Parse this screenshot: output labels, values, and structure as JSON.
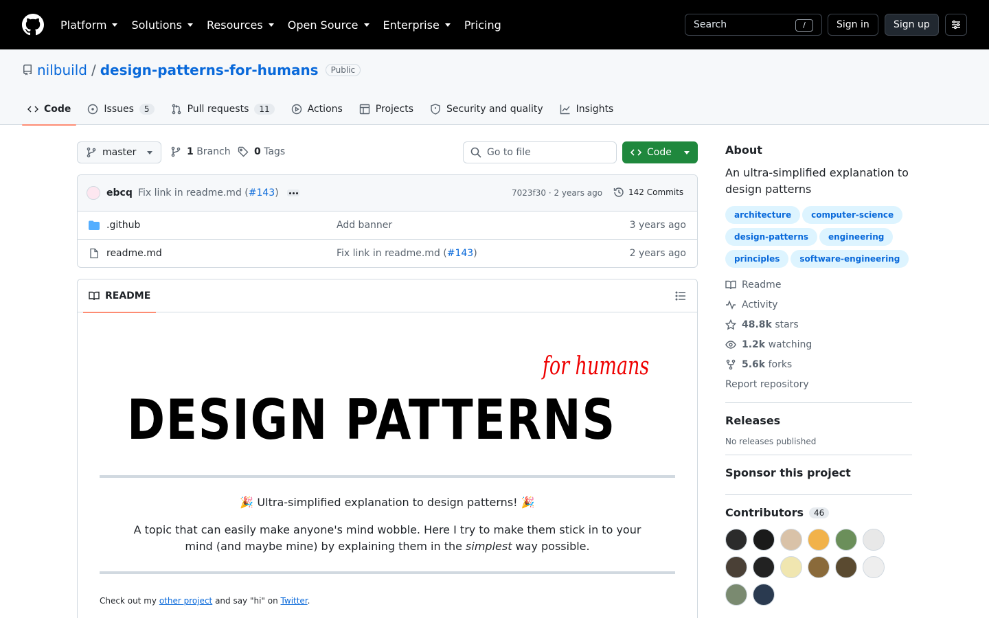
{
  "header": {
    "nav": [
      "Platform",
      "Solutions",
      "Resources",
      "Open Source",
      "Enterprise",
      "Pricing"
    ],
    "nav_dropdown": [
      true,
      true,
      true,
      true,
      true,
      false
    ],
    "search_label": "Search",
    "search_key": "/",
    "sign_in": "Sign in",
    "sign_up": "Sign up"
  },
  "repo": {
    "owner": "nilbuild",
    "separator": "/",
    "name": "design-patterns-for-humans",
    "visibility": "Public"
  },
  "tabs": [
    {
      "label": "Code",
      "icon": "code-icon",
      "count": ""
    },
    {
      "label": "Issues",
      "icon": "issue-icon",
      "count": "5"
    },
    {
      "label": "Pull requests",
      "icon": "pull-request-icon",
      "count": "11"
    },
    {
      "label": "Actions",
      "icon": "play-icon",
      "count": ""
    },
    {
      "label": "Projects",
      "icon": "table-icon",
      "count": ""
    },
    {
      "label": "Security and quality",
      "icon": "shield-icon",
      "count": ""
    },
    {
      "label": "Insights",
      "icon": "graph-icon",
      "count": ""
    }
  ],
  "toolbar": {
    "branch": "master",
    "branch_count": "1",
    "branch_label": "Branch",
    "tag_count": "0",
    "tag_label": "Tags",
    "goto_placeholder": "Go to file",
    "code_label": "Code"
  },
  "commit": {
    "author": "ebcq",
    "message": "Fix link in readme.md (",
    "pr": "#143",
    "message_end": ")",
    "sha_time": "7023f30 · 2 years ago",
    "commits": "142 Commits"
  },
  "files": [
    {
      "name": ".github",
      "type": "folder",
      "message": "Add banner",
      "message_link": "",
      "message_end": "",
      "date": "3 years ago"
    },
    {
      "name": "readme.md",
      "type": "file",
      "message": "Fix link in readme.md (",
      "message_link": "#143",
      "message_end": ")",
      "date": "2 years ago"
    }
  ],
  "readme": {
    "tab": "README",
    "banner_small": "for humans",
    "banner_big": "DESIGN PATTERNS",
    "lead": "🎉 Ultra-simplified explanation to design patterns! 🎉",
    "desc_1": "A topic that can easily make anyone's mind wobble. Here I try to make them stick in to your mind (and maybe mine) by explaining them in the ",
    "desc_em": "simplest",
    "desc_2": " way possible.",
    "checkout_1": "Check out my ",
    "checkout_link1": "other project",
    "checkout_2": " and say \"hi\" on ",
    "checkout_link2": "Twitter",
    "checkout_3": "."
  },
  "about": {
    "title": "About",
    "description": "An ultra-simplified explanation to design patterns",
    "topics": [
      "architecture",
      "computer-science",
      "design-patterns",
      "engineering",
      "principles",
      "software-engineering"
    ],
    "readme": "Readme",
    "activity": "Activity",
    "stars_count": "48.8k",
    "stars_label": "stars",
    "watching_count": "1.2k",
    "watching_label": "watching",
    "forks_count": "5.6k",
    "forks_label": "forks",
    "report": "Report repository"
  },
  "releases": {
    "title": "Releases",
    "empty": "No releases published"
  },
  "sponsor": {
    "title": "Sponsor this project"
  },
  "contributors": {
    "title": "Contributors",
    "count": "46",
    "avatar_colors": [
      "#2b2b2b",
      "#1a1a1a",
      "#d9c2a8",
      "#f1b24a",
      "#6b8f5a",
      "#e8e8e8",
      "#4a4036",
      "#222222",
      "#f0e6b0",
      "#8a6a3a",
      "#5a4a30",
      "#eeeeee",
      "#7a8a70",
      "#2a3a50"
    ]
  },
  "colors": {
    "accent": "#0969da",
    "green": "#1f883d",
    "tab_underline": "#fd8c73",
    "topic_bg": "#ddf4ff"
  }
}
